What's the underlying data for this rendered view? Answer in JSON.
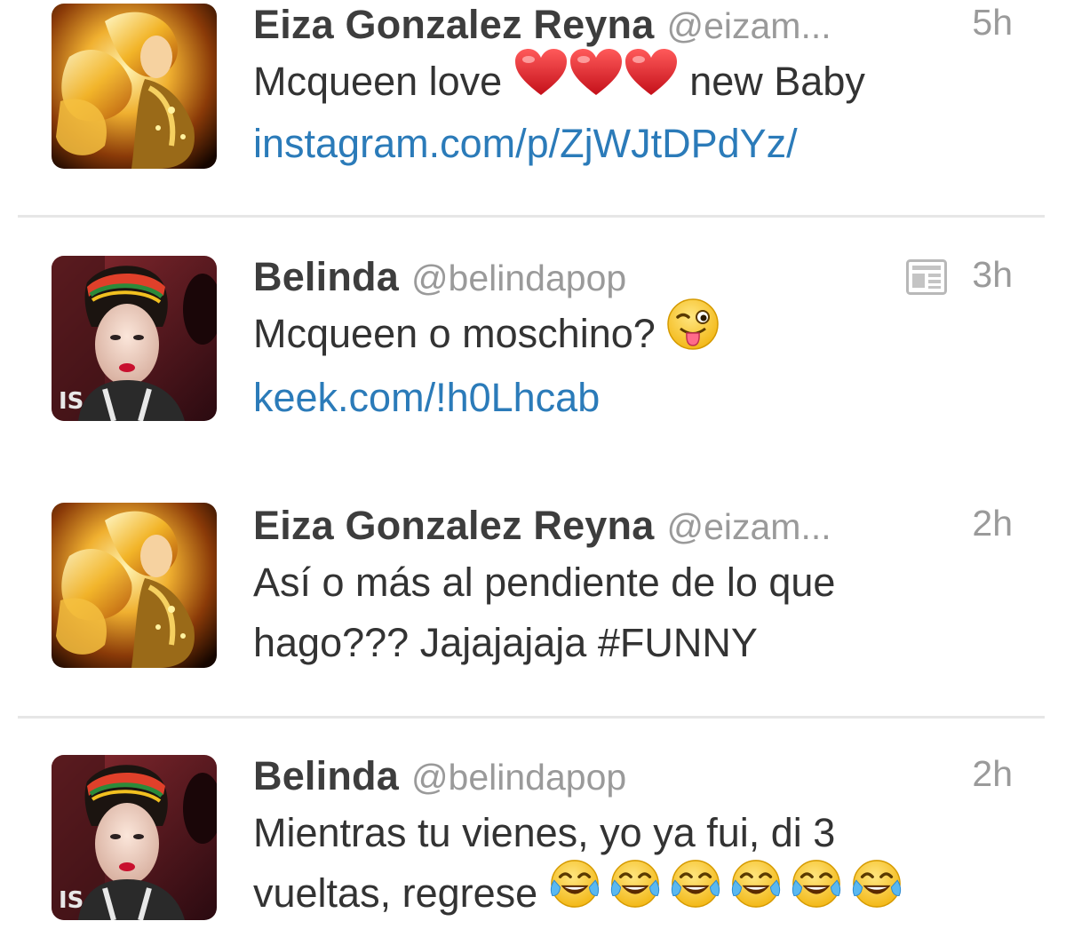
{
  "tweets": [
    {
      "name": "Eiza Gonzalez Reyna",
      "handle": "@eizam...",
      "time": "5h",
      "text_before": "Mcqueen love",
      "text_after": "new Baby",
      "emoji": "red-heart",
      "emoji_count": 3,
      "link": "instagram.com/p/ZjWJtDPdYz/"
    },
    {
      "name": "Belinda",
      "handle": "@belindapop",
      "time": "3h",
      "has_media_icon": true,
      "text": "Mcqueen o moschino?",
      "emoji": "winking-tongue-face",
      "link": "keek.com/!h0Lhcab"
    },
    {
      "name": "Eiza Gonzalez Reyna",
      "handle": "@eizam...",
      "time": "2h",
      "text_line1": "Así o más al pendiente de lo que",
      "text_line2": "hago??? Jajajajaja #FUNNY"
    },
    {
      "name": "Belinda",
      "handle": "@belindapop",
      "time": "2h",
      "text_line1": "Mientras tu vienes, yo ya fui, di 3",
      "text_line2": "vueltas, regrese",
      "emoji": "tears-of-joy-face",
      "emoji_count": 6
    }
  ],
  "colors": {
    "link": "#2b7bb9",
    "name": "#3d3d3d",
    "meta": "#9a9a9a",
    "divider": "#e6e6e6"
  }
}
